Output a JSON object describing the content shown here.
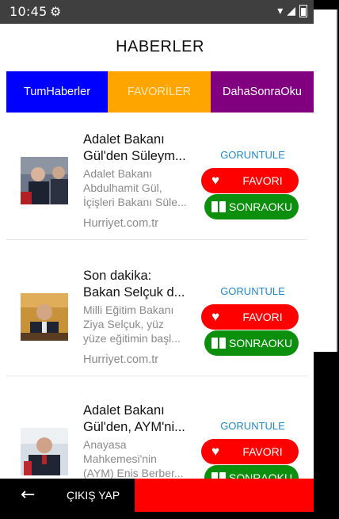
{
  "status_bar": {
    "time": "10:45"
  },
  "header": {
    "title": "HABERLER"
  },
  "tabs": [
    {
      "label": "TumHaberler",
      "color": "#0000ff"
    },
    {
      "label": "FAVORİLER",
      "color": "#ffa500"
    },
    {
      "label": "DahaSonraOku",
      "color": "#800080"
    }
  ],
  "articles": [
    {
      "headline_line1": "Adalet Bakanı",
      "headline_line2": "Gül'den Süleym...",
      "summary_line1": "Adalet Bakanı",
      "summary_line2": "Abdulhamit Gül,",
      "summary_line3": "İçişleri Bakanı Süle...",
      "source": "Hurriyet.com.tr",
      "view_label": "GORUNTULE",
      "favorite_label": "FAVORI",
      "later_label": "SONRAOKU"
    },
    {
      "headline_line1": "Son dakika:",
      "headline_line2": "Bakan Selçuk d...",
      "summary_line1": "Milli Eğitim Bakanı",
      "summary_line2": "Ziya Selçuk, yüz",
      "summary_line3": "yüze eğitimin başl...",
      "source": "Hurriyet.com.tr",
      "view_label": "GORUNTULE",
      "favorite_label": "FAVORI",
      "later_label": "SONRAOKU"
    },
    {
      "headline_line1": "Adalet Bakanı",
      "headline_line2": "Gül'den, AYM'ni...",
      "summary_line1": "Anayasa",
      "summary_line2": "Mahkemesi'nin",
      "summary_line3": "(AYM) Enis Berber...",
      "source": "",
      "view_label": "GORUNTULE",
      "favorite_label": "FAVORI",
      "later_label": "SONRAOKU"
    }
  ],
  "bottom_bar": {
    "exit_label": "ÇIKIŞ YAP"
  },
  "colors": {
    "favorite": "#ff0000",
    "later": "#0c8f0c",
    "link": "#1e88d0"
  }
}
